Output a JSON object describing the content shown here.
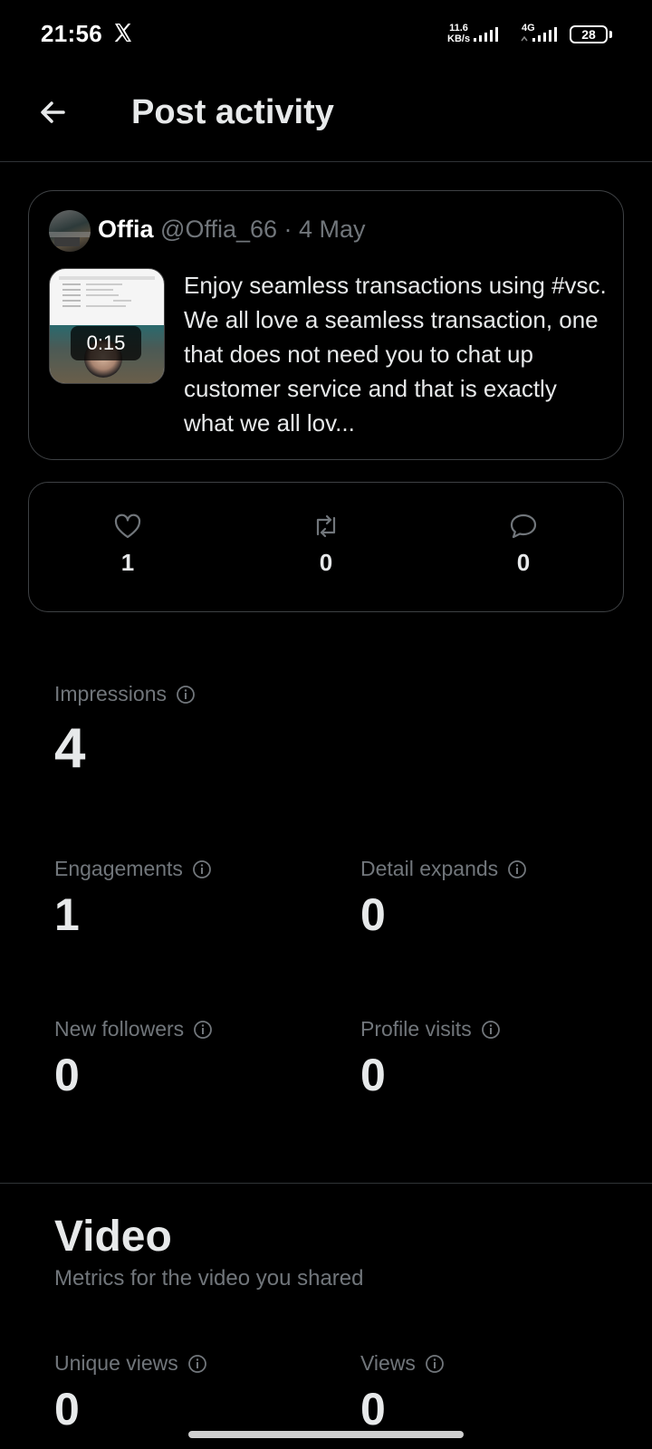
{
  "status_bar": {
    "time": "21:56",
    "net_speed_value": "11.6",
    "net_speed_unit": "KB/s",
    "network_type": "4G",
    "battery": "28"
  },
  "header": {
    "title": "Post activity"
  },
  "post": {
    "author_name": "Offia",
    "author_meta": "@Offia_66 · 4 May",
    "video_duration": "0:15",
    "text": "Enjoy seamless transactions using #vsc. We all love a seamless transaction, one that does not need you to chat up customer service and that is exactly what we all lov..."
  },
  "engagement": {
    "likes": "1",
    "reposts": "0",
    "replies": "0"
  },
  "metrics": {
    "impressions": {
      "label": "Impressions",
      "value": "4"
    },
    "engagements": {
      "label": "Engagements",
      "value": "1"
    },
    "detail_expands": {
      "label": "Detail expands",
      "value": "0"
    },
    "new_followers": {
      "label": "New followers",
      "value": "0"
    },
    "profile_visits": {
      "label": "Profile visits",
      "value": "0"
    }
  },
  "video": {
    "title": "Video",
    "subtitle": "Metrics for the video you shared",
    "unique_views": {
      "label": "Unique views",
      "value": "0"
    },
    "views": {
      "label": "Views",
      "value": "0"
    }
  },
  "colors": {
    "background": "#000000",
    "text_primary": "#e7e9ea",
    "text_secondary": "#71767b",
    "border": "#3e4144"
  }
}
